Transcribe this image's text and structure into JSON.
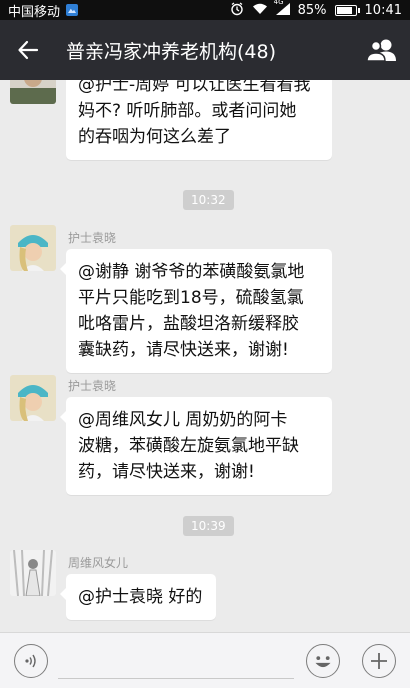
{
  "status_bar": {
    "carrier": "中国移动",
    "network": "4G",
    "battery_percent": 85,
    "battery_label": "85%",
    "time": "10:41"
  },
  "nav": {
    "title": "普亲冯家冲养老机构(48)",
    "back_icon": "back-arrow-icon",
    "members_icon": "group-members-icon"
  },
  "messages": [
    {
      "sender": "",
      "text_lines": [
        "@护士-周婷 可以让医生看看我",
        "妈不? 听听肺部。或者问问她",
        "的吞咽为何这么差了"
      ]
    },
    {
      "time": "10:32"
    },
    {
      "sender": "护士袁晓",
      "text_lines": [
        "@谢静 谢爷爷的苯磺酸氨氯地",
        "平片只能吃到18号，硫酸氢氯",
        "吡咯雷片，盐酸坦洛新缓释胶",
        "囊缺药，请尽快送来，谢谢!"
      ]
    },
    {
      "sender": "护士袁晓",
      "text_lines": [
        "@周维风女儿 周奶奶的阿卡",
        "波糖，苯磺酸左旋氨氯地平缺",
        "药，请尽快送来，谢谢!"
      ]
    },
    {
      "time": "10:39"
    },
    {
      "sender": "周维风女儿",
      "text_lines": [
        "@护士袁晓 好的"
      ]
    }
  ],
  "input_bar": {
    "voice_icon": "voice-icon",
    "input_value": "",
    "emoji_icon": "emoji-icon",
    "add_icon": "plus-icon"
  },
  "colors": {
    "nav_bg": "#2b2c31",
    "chat_bg": "#ebebeb",
    "bubble_bg": "#ffffff",
    "time_pill": "#cecece"
  }
}
